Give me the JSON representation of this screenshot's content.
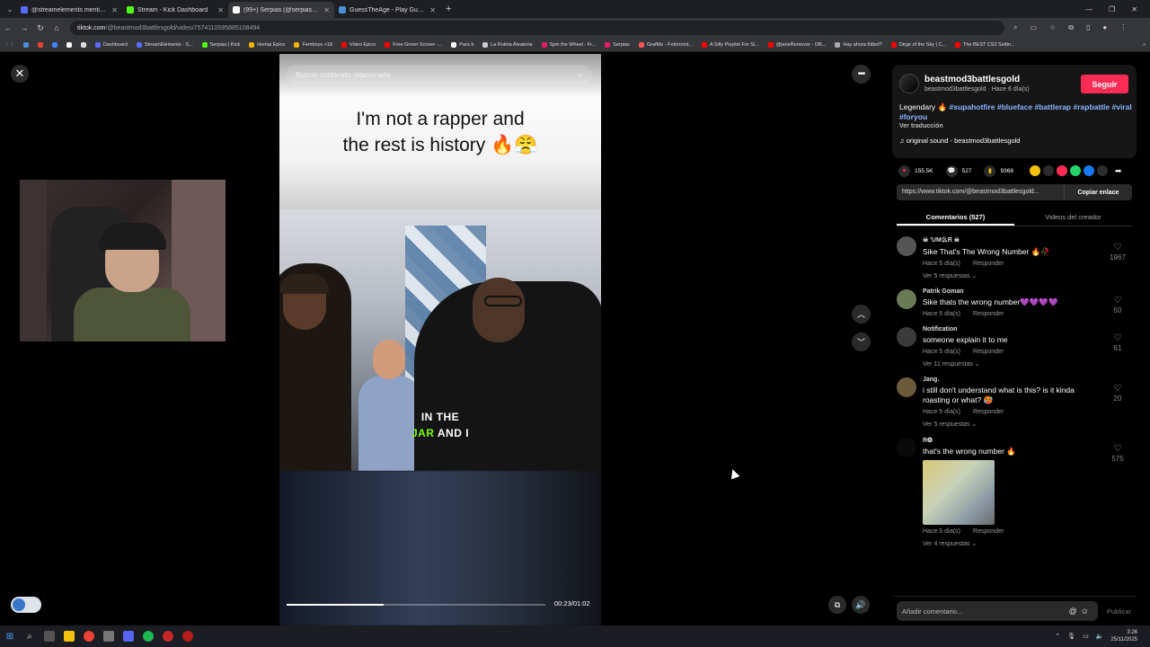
{
  "browser": {
    "tabs": [
      {
        "title": "@streamelements mentione",
        "color": "#5b6bff",
        "active": false
      },
      {
        "title": "Stream - Kick Dashboard",
        "color": "#53fc18",
        "active": false
      },
      {
        "title": "(99+) Serpias (@serpias) | TikTok",
        "color": "#ffffff",
        "active": true
      },
      {
        "title": "GuessTheAge - Play Guess The",
        "color": "#4a90d9",
        "active": false
      }
    ],
    "url_host": "tiktok.com",
    "url_path": "/@beastmod3battlesgold/video/7574110595885108494",
    "bookmarks": [
      {
        "label": "",
        "color": "#4a90d9"
      },
      {
        "label": "",
        "color": "#ea4335"
      },
      {
        "label": "",
        "color": "#4285f4"
      },
      {
        "label": "",
        "color": "#ffffff"
      },
      {
        "label": "",
        "color": "#dddddd"
      },
      {
        "label": "Dashboard",
        "color": "#5b6bff"
      },
      {
        "label": "StreamElements - S...",
        "color": "#5b6bff"
      },
      {
        "label": "Serpias | Kick",
        "color": "#53fc18"
      },
      {
        "label": "Hentai Epico",
        "color": "#f4b400"
      },
      {
        "label": "Femboys +18",
        "color": "#f4b400"
      },
      {
        "label": "Video Epico",
        "color": "#ff0000"
      },
      {
        "label": "Free Green Screen -...",
        "color": "#ff0000"
      },
      {
        "label": "Para ti",
        "color": "#ffffff"
      },
      {
        "label": "La Ruleta Aleatoria",
        "color": "#cccccc"
      },
      {
        "label": "Spin the Wheel - Fr...",
        "color": "#e91e63"
      },
      {
        "label": "Serpias",
        "color": "#e91e63"
      },
      {
        "label": "GrafMe - Fotomont...",
        "color": "#ff5252"
      },
      {
        "label": "A Silly Playlist For Si...",
        "color": "#ff0000"
      },
      {
        "label": "@janeRemover - OB...",
        "color": "#ff0000"
      },
      {
        "label": "Hay ahora fútbol?",
        "color": "#aaaaaa"
      },
      {
        "label": "Dirge of the Sky | C...",
        "color": "#ff0000"
      },
      {
        "label": "The BEST CS2 Settin...",
        "color": "#ff0000"
      }
    ]
  },
  "video": {
    "search_placeholder": "Buscar contenido relacionado",
    "caption_line1": "I'm not a rapper and",
    "caption_line2": "the rest is history 🔥😤",
    "subtitle_line1": "IN THE",
    "subtitle_green": "JAR",
    "subtitle_rest": " AND I",
    "time": "00:23/01:02",
    "progress": 0.375
  },
  "creator": {
    "name": "beastmod3battlesgold",
    "sub": "beastmod3battlesgold · Hace 6 día(s)",
    "follow_label": "Seguir",
    "desc_text": "Legendary 🔥",
    "tags": [
      "#supahotfire",
      "#blueface",
      "#battlerap",
      "#rapbattle",
      "#viral",
      "#foryou"
    ],
    "translate": "Ver traducción",
    "sound": "♫  original sound - beastmod3battlesgold"
  },
  "stats": {
    "likes": "155.5K",
    "comments": "527",
    "saves": "9368"
  },
  "share_colors": [
    "#f4c20d",
    "#2b2b2b",
    "#fe2c55",
    "#25d366",
    "#1877f2",
    "#2b2b2b"
  ],
  "link": {
    "url": "https://www.tiktok.com/@beastmod3battlesgold...",
    "copy_label": "Copiar enlace"
  },
  "panel_tabs": {
    "comments": "Comentarios (527)",
    "creator_videos": "Videos del creador"
  },
  "comments": [
    {
      "name": "☠ 'UM么R ☠",
      "text": "Sike That's The Wrong Number 🔥🥀",
      "time": "Hace 5 día(s)",
      "reply": "Responder",
      "replies": "Ver 5 respuestas ⌄",
      "likes": "1967",
      "avatar": "#555"
    },
    {
      "name": "Patrik Goman",
      "text": "Sike thats the wrong number💜💜💜💜",
      "time": "Hace 5 día(s)",
      "reply": "Responder",
      "replies": "",
      "likes": "50",
      "avatar": "#6a7a55"
    },
    {
      "name": "Notification",
      "text": "someone explain it to me",
      "time": "Hace 5 día(s)",
      "reply": "Responder",
      "replies": "Ver 11 respuestas ⌄",
      "likes": "61",
      "avatar": "#3a3a3a"
    },
    {
      "name": "Jang.",
      "text": "i still don't understand what is this? is it kinda roasting or what? 🥵",
      "time": "Hace 5 día(s)",
      "reply": "Responder",
      "replies": "Ver 5 respuestas ⌄",
      "likes": "20",
      "avatar": "#6b5a3a"
    },
    {
      "name": "R❂",
      "text": "that's the wrong number 🔥",
      "time": "Hace 5 día(s)",
      "reply": "Responder",
      "replies": "Ver 4 respuestas ⌄",
      "likes": "575",
      "avatar": "#0a0a0a",
      "has_image": true
    }
  ],
  "add_comment": {
    "placeholder": "Añadir comentario...",
    "publish": "Publicar"
  },
  "clock": {
    "time": "3:26",
    "date": "25/11/2025"
  }
}
